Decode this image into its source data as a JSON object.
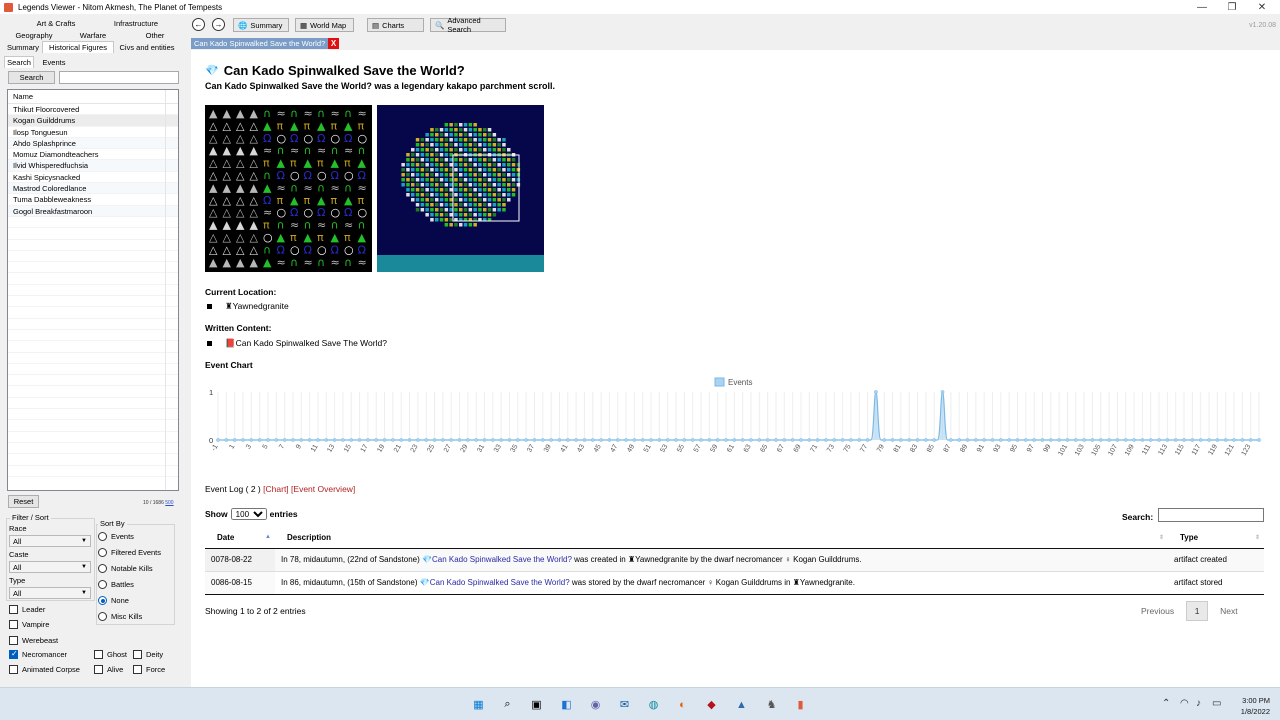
{
  "window": {
    "title": "Legends Viewer - Nitom Akmesh, The Planet of Tempests"
  },
  "left_panel": {
    "tab_rows": [
      [
        "Art & Crafts",
        "Infrastructure"
      ],
      [
        "Geography",
        "Warfare",
        "Other"
      ],
      [
        "Summary",
        "Historical Figures",
        "Civs and entities"
      ]
    ],
    "sub_tabs": [
      "Search",
      "Events"
    ],
    "search_button": "Search",
    "search_value": "",
    "list_header": "Name",
    "list_items": [
      "Thikut Floorcovered",
      "Kogan Guilddrums",
      "Ilosp Tonguesun",
      "Ahdo Splashprince",
      "Momuz Diamondteachers",
      "Ilvid Whisperedfuchsia",
      "Kashi Spicysnacked",
      "Mastrod Coloredlance",
      "Tuma Dabbleweakness",
      "Gogol Breakfastmaroon"
    ],
    "selected_index": 1,
    "reset_button": "Reset",
    "count_text": "10 / 1686",
    "count_link": "500",
    "filter_title": "Filter / Sort",
    "race_label": "Race",
    "race_value": "All",
    "caste_label": "Caste",
    "caste_value": "All",
    "type_label": "Type",
    "type_value": "All",
    "sort_title": "Sort By",
    "sort_options": [
      "Events",
      "Filtered Events",
      "Notable Kills",
      "Battles",
      "None",
      "Misc Kills"
    ],
    "sort_selected": "None",
    "checkboxes": [
      {
        "label": "Leader",
        "checked": false
      },
      {
        "label": "Vampire",
        "checked": false
      },
      {
        "label": "Werebeast",
        "checked": false
      },
      {
        "label": "Necromancer",
        "checked": true
      },
      {
        "label": "Ghost",
        "checked": false
      },
      {
        "label": "Deity",
        "checked": false
      },
      {
        "label": "Animated Corpse",
        "checked": false
      },
      {
        "label": "Alive",
        "checked": false
      },
      {
        "label": "Force",
        "checked": false
      }
    ]
  },
  "toolbar": {
    "back_icon": "back-arrow-icon",
    "forward_icon": "forward-arrow-icon",
    "summary_label": "Summary",
    "world_map_label": "World Map",
    "charts_label": "Charts",
    "advanced_search_label": "Advanced Search",
    "version": "v1.20.08"
  },
  "doc_tab": {
    "title": "Can Kado Spinwalked Save the World?",
    "close": "X"
  },
  "artifact": {
    "title": "Can Kado Spinwalked Save the World?",
    "description": "Can Kado Spinwalked Save the World? was a legendary kakapo parchment scroll.",
    "current_location_label": "Current Location:",
    "current_location": "Yawnedgranite",
    "written_content_label": "Written Content:",
    "written_content": "Can Kado Spinwalked Save The World?",
    "event_chart_label": "Event Chart"
  },
  "chart_data": {
    "type": "area",
    "legend": [
      "Events"
    ],
    "legend_position": "top-center",
    "series": [
      {
        "name": "Events",
        "color": "#a8d4f2",
        "points": [
          [
            78,
            1
          ],
          [
            86,
            1
          ]
        ]
      }
    ],
    "x_min": -1,
    "x_max": 124,
    "x_tick_labels": [
      "-1",
      "1",
      "3",
      "5",
      "7",
      "9",
      "11",
      "13",
      "15",
      "17",
      "19",
      "21",
      "23",
      "25",
      "27",
      "29",
      "31",
      "33",
      "35",
      "37",
      "39",
      "41",
      "43",
      "45",
      "47",
      "49",
      "51",
      "53",
      "55",
      "57",
      "59",
      "61",
      "63",
      "65",
      "67",
      "69",
      "71",
      "73",
      "75",
      "77",
      "79",
      "81",
      "83",
      "85",
      "87",
      "89",
      "91",
      "93",
      "95",
      "97",
      "99",
      "101",
      "103",
      "105",
      "107",
      "109",
      "111",
      "113",
      "115",
      "117",
      "119",
      "121",
      "123"
    ],
    "ylim": [
      0,
      1
    ],
    "y_ticks": [
      "0",
      "1"
    ],
    "grid": true
  },
  "event_log": {
    "label": "Event Log",
    "count": "( 2 )",
    "chart_link": "[Chart]",
    "overview_link": "[Event Overview]",
    "show_label": "Show",
    "entries_value": "100",
    "entries_label": "entries",
    "search_label": "Search:",
    "columns": [
      "Date",
      "Description",
      "Type"
    ],
    "rows": [
      {
        "date": "0078-08-22",
        "desc_prefix": "In 78, midautumn, (22nd of Sandstone)",
        "artifact": "Can Kado Spinwalked Save the World?",
        "desc_mid": "was created in",
        "site": "Yawnedgranite",
        "desc_mid2": "by the dwarf necromancer",
        "figure": "Kogan Guilddrums.",
        "type": "artifact created"
      },
      {
        "date": "0086-08-15",
        "desc_prefix": "In 86, midautumn, (15th of Sandstone)",
        "artifact": "Can Kado Spinwalked Save the World?",
        "desc_mid": "was stored by the dwarf necromancer",
        "figure": "Kogan Guilddrums",
        "desc_mid2": "in",
        "site": "Yawnedgranite.",
        "type": "artifact stored"
      }
    ],
    "footer": "Showing 1 to 2 of 2 entries",
    "prev": "Previous",
    "page": "1",
    "next": "Next"
  },
  "taskbar": {
    "time": "3:00 PM",
    "date": "1/8/2022"
  }
}
